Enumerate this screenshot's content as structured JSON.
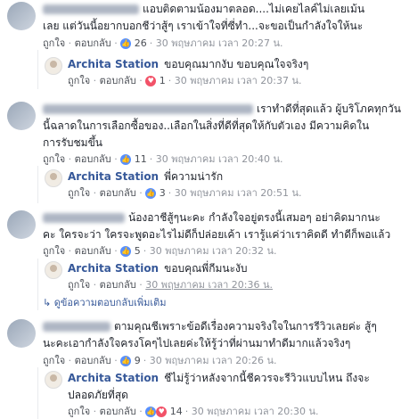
{
  "actions": {
    "like": "ถูกใจ",
    "reply": "ตอบกลับ",
    "dot": "·"
  },
  "replier": {
    "name": "Archita Station"
  },
  "comments": [
    {
      "lines": [
        "แอบติดตามน้องมาตลอด....ไม่เคยไลค์ไม่เลยเม้น",
        "เลย แต่วันนี้อยากบอกชีว่าสู้ๆ เราเข้าใจที่ซี่ทำ...จะขอเป็นกำลังใจให้นะ"
      ],
      "reactions": "26",
      "time": "30 พฤษภาคม เวลา 20:27 น.",
      "reply": {
        "text": "ขอบคุณมากงับ ขอบคุณใจจริงๆ",
        "reactions": "1",
        "time": "30 พฤษภาคม เวลา 20:37 น."
      }
    },
    {
      "lines": [
        "เราทำดีที่สุดแล้ว ผู้บริโภคทุกวัน",
        "นี้ฉลาดในการเลือกซื้อของ..เลือกในสิ่งที่ดีที่สุดให้กับตัวเอง มีความคิดใน",
        "การรับชมขึ้น"
      ],
      "reactions": "11",
      "time": "30 พฤษภาคม เวลา 20:40 น.",
      "reply": {
        "text": "พี่ความน่ารัก",
        "reactions": "3",
        "time": "30 พฤษภาคม เวลา 20:51 น."
      }
    },
    {
      "lines": [
        "น้องอาชีสู้ๆนะคะ กำลังใจอยู่ตรงนี้เสมอๆ อย่าคิดมากนะ",
        "คะ ใครจะว่า ใครจะพูดอะไรไม่ดีก็ปล่อยเค้า เรารู้แค่ว่าเราคิดดี ทำดีก็พอแล้ว"
      ],
      "reactions": "5",
      "time": "30 พฤษภาคม เวลา 20:32 น.",
      "reply": {
        "text": "ขอบคุณพี่กีมนะงับ",
        "reactions": "",
        "time": "30 พฤษภาคม เวลา 20:36 น."
      },
      "more": "ดูข้อความตอบกลับเพิ่มเติม"
    },
    {
      "lines": [
        "ตามคุณชีเพราะข้อดีเรื่องความจริงใจในการรีวิวเลยค่ะ สู้ๆ",
        "นะคะเอากำลังใจครงโคๆไปเลยค่ะให้รู้ว่าที่ผ่านมาทำดีมากแล้วจริงๆ"
      ],
      "reactions": "9",
      "time": "30 พฤษภาคม เวลา 20:26 น.",
      "reply": {
        "lines": [
          "ชีไม่รู้ว่าหลังจากนี้ชีควรจะรีวิวแบบไหน ถึงจะ",
          "ปลอดภัยที่สุด"
        ],
        "reactions": "14",
        "time": "30 พฤษภาคม เวลา 20:30 น."
      }
    }
  ]
}
